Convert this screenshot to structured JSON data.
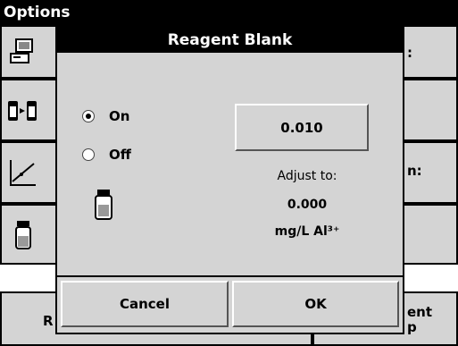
{
  "background": {
    "title": "Options",
    "right_labels": [
      ":",
      "n:",
      "ent",
      "p"
    ],
    "left_label": "R",
    "icons": [
      "computer-icon",
      "sample-transfer-icon",
      "graph-icon",
      "vial-icon"
    ]
  },
  "dialog": {
    "title": "Reagent Blank",
    "radio_on": "On",
    "radio_off": "Off",
    "selected": "On",
    "value_button": "0.010",
    "adjust_label": "Adjust to:",
    "adjust_value": "0.000",
    "unit": "mg/L Al³⁺",
    "cancel": "Cancel",
    "ok": "OK",
    "vial_icon": "vial-icon"
  }
}
